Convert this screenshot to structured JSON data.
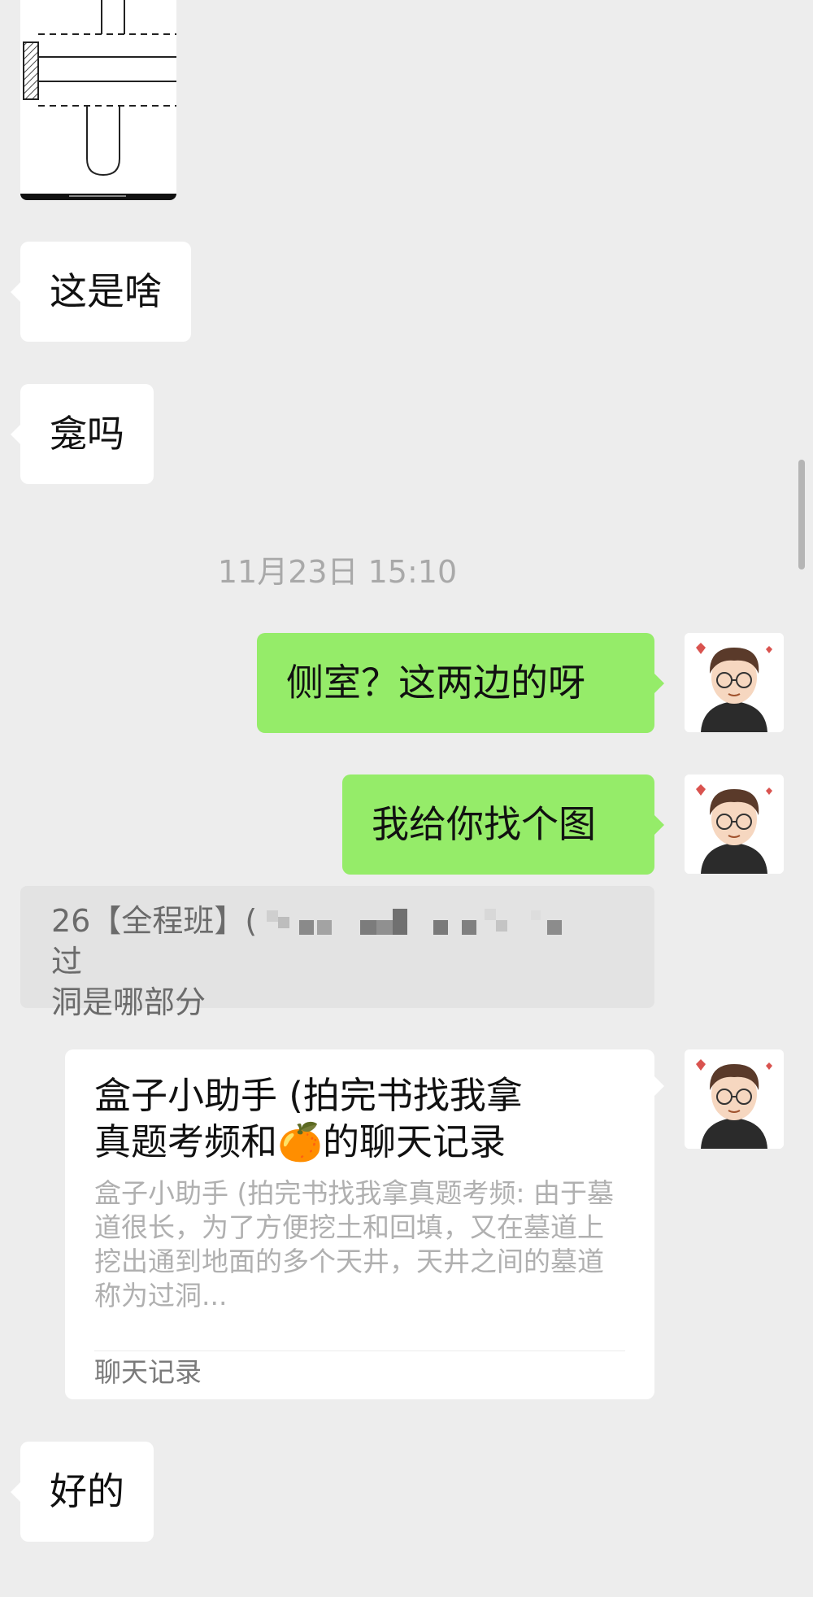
{
  "messages": {
    "m1": "这是啥",
    "m2": "龛吗",
    "timestamp": "11月23日 15:10",
    "m3": "侧室？这两边的呀",
    "m4": "我给你找个图",
    "m5": "好的"
  },
  "quote": {
    "prefix": "26【全程班】(",
    "suffix": "过",
    "line2": "洞是哪部分"
  },
  "card": {
    "title_a": "盒子小助手 (拍完书找我拿",
    "title_b": "真题考频和",
    "title_emoji": "🍊",
    "title_c": "的聊天记录",
    "body": "盒子小助手 (拍完书找我拿真题考频: 由于墓道很长，为了方便挖土和回填，又在墓道上挖出通到地面的多个天井，天井之间的墓道称为过洞...",
    "footer": "聊天记录"
  },
  "colors": {
    "background": "#ededed",
    "outgoing_bubble": "#95ec69",
    "incoming_bubble": "#ffffff"
  },
  "icons": [
    "user-avatar"
  ]
}
